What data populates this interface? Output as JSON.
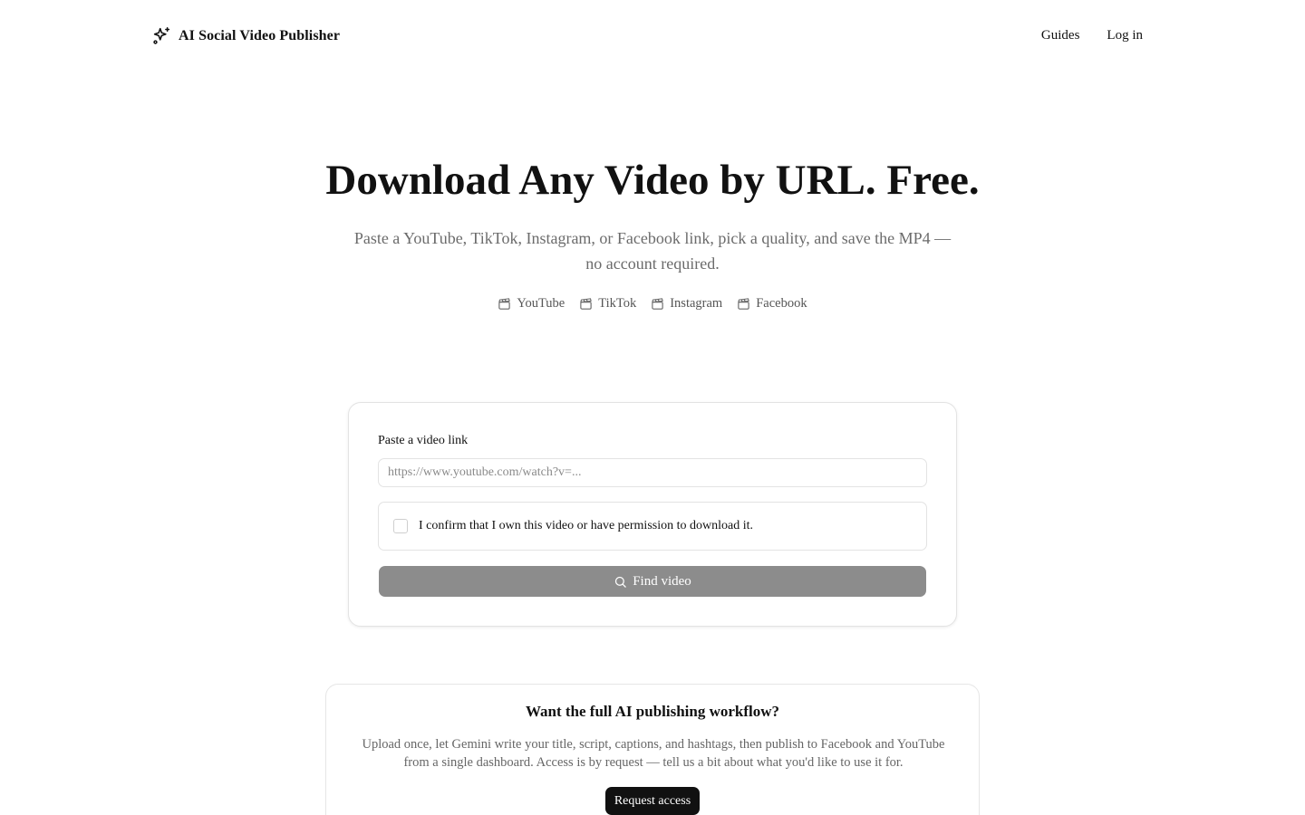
{
  "header": {
    "brand_name": "AI Social Video Publisher",
    "brand_icon": "sparkles-icon",
    "nav": {
      "guides": "Guides",
      "login": "Log in"
    }
  },
  "hero": {
    "title": "Download Any Video by URL. Free.",
    "subtitle": "Paste a YouTube, TikTok, Instagram, or Facebook link, pick a quality, and save the MP4 — no account required.",
    "platforms": [
      {
        "label": "YouTube",
        "icon": "clapperboard-icon"
      },
      {
        "label": "TikTok",
        "icon": "clapperboard-icon"
      },
      {
        "label": "Instagram",
        "icon": "clapperboard-icon"
      },
      {
        "label": "Facebook",
        "icon": "clapperboard-icon"
      }
    ]
  },
  "form": {
    "label": "Paste a video link",
    "url_value": "",
    "url_placeholder": "https://www.youtube.com/watch?v=...",
    "confirm_text": "I confirm that I own this video or have permission to download it.",
    "confirm_checked": false,
    "find_button": "Find video",
    "find_button_color": "#8c8c8c"
  },
  "promo": {
    "title": "Want the full AI publishing workflow?",
    "text": "Upload once, let Gemini write your title, script, captions, and hashtags, then publish to Facebook and YouTube from a single dashboard. Access is by request — tell us a bit about what you'd like to use it for.",
    "button": "Request access"
  }
}
